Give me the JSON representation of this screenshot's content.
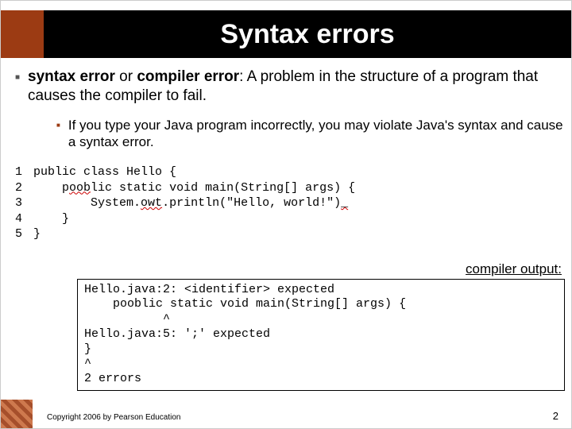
{
  "title": "Syntax errors",
  "main_bullet": {
    "term": "syntax error",
    "alt": " or ",
    "term2": "compiler error",
    "rest": ": A problem in the structure of a program that causes the compiler to fail."
  },
  "sub_bullet": "If you type your Java program incorrectly, you may violate Java's syntax and cause a syntax error.",
  "code": {
    "line_numbers": "1\n2\n3\n4\n5",
    "l1": "public class Hello {",
    "l2a": "    p",
    "l2b": "oob",
    "l2c": "lic static void main(String[] args) {",
    "l3a": "        System.",
    "l3b": "owt",
    "l3c": ".println(\"Hello, world!\")",
    "l3d": "_",
    "l4": "    }",
    "l5": "}"
  },
  "output_label": "compiler output:",
  "output_text": "Hello.java:2: <identifier> expected\n    pooblic static void main(String[] args) {\n           ^\nHello.java:5: ';' expected\n}\n^\n2 errors",
  "copyright": "Copyright 2006 by Pearson Education",
  "page": "2"
}
